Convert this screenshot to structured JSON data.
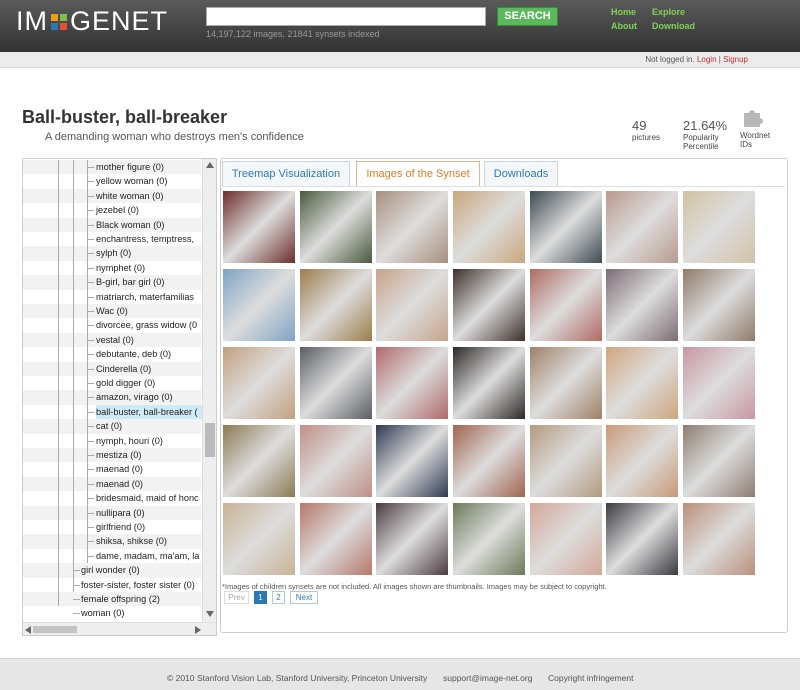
{
  "header": {
    "logo_left": "IM",
    "logo_right": "GENET",
    "logo_colors": [
      "#f39c12",
      "#7cc242",
      "#2a79b6",
      "#e74c3c"
    ],
    "search_placeholder": "",
    "search_button": "SEARCH",
    "stats": "14,197,122 images, 21841 synsets indexed",
    "nav": {
      "home": "Home",
      "about": "About",
      "explore": "Explore",
      "download": "Download"
    }
  },
  "account": {
    "status": "Not logged in.",
    "login": "Login",
    "separator": "|",
    "signup": "Signup"
  },
  "synset": {
    "title": "Ball-buster, ball-breaker",
    "gloss": "A demanding woman who destroys men's confidence",
    "pictures_value": "49",
    "pictures_label": "pictures",
    "popularity_value": "21.64%",
    "popularity_label_1": "Popularity",
    "popularity_label_2": "Percentile",
    "wordnet_label_1": "Wordnet",
    "wordnet_label_2": "IDs"
  },
  "tree": {
    "items": [
      "mother figure (0)",
      "yellow woman (0)",
      "white woman (0)",
      "jezebel (0)",
      "Black woman (0)",
      "enchantress, temptress,",
      "sylph (0)",
      "nymphet (0)",
      "B-girl, bar girl (0)",
      "matriarch, materfamilias",
      "Wac (0)",
      "divorcee, grass widow (0",
      "vestal (0)",
      "debutante, deb (0)",
      "Cinderella (0)",
      "gold digger (0)",
      "amazon, virago (0)",
      "ball-buster, ball-breaker (",
      "cat (0)",
      "nymph, houri (0)",
      "mestiza (0)",
      "maenad (0)",
      "maenad (0)",
      "bridesmaid, maid of honc",
      "nullipara (0)",
      "girlfriend (0)",
      "shiksa, shikse (0)",
      "dame, madam, ma'am, la",
      "girl wonder (0)",
      "foster-sister, foster sister (0)",
      "female offspring (2)",
      "woman (0)"
    ],
    "cut_off_row": "(0)"
  },
  "tabs": [
    {
      "label": "Treemap Visualization",
      "active": false
    },
    {
      "label": "Images of the Synset",
      "active": true
    },
    {
      "label": "Downloads",
      "active": false
    }
  ],
  "gallery": {
    "thumbnails": [
      "#6b2d2a",
      "#4a5a3d",
      "#a88f7e",
      "#c9a77e",
      "#3e4a52",
      "#b89a8f",
      "#d2c2a6",
      "#7fa3c4",
      "#9c7d4c",
      "#c6a48b",
      "#3d2f2a",
      "#b06a63",
      "#7b6c73",
      "#8f7a6a",
      "#c2a080",
      "#5b5d63",
      "#b0686a",
      "#2c2826",
      "#9f8167",
      "#cfa57e",
      "#c896a3",
      "#8c7a55",
      "#bf8f86",
      "#2e3850",
      "#a0634f",
      "#b39a7f",
      "#c89a78",
      "#8d7d72",
      "#c9b295",
      "#b5776a",
      "#4a3b40",
      "#6b7a58",
      "#d3a797",
      "#3a3a40",
      "#ba8f7a"
    ],
    "note": "*Images of children synsets are not included. All images shown are thumbnails. Images may be subject to copyright.",
    "pager": {
      "prev": "Prev",
      "page1": "1",
      "page2": "2",
      "next": "Next"
    }
  },
  "footer": {
    "copyright": "© 2010",
    "labs": "Stanford Vision Lab, Stanford University, Princeton University",
    "email": "support@image-net.org",
    "infringement": "Copyright infringement"
  }
}
